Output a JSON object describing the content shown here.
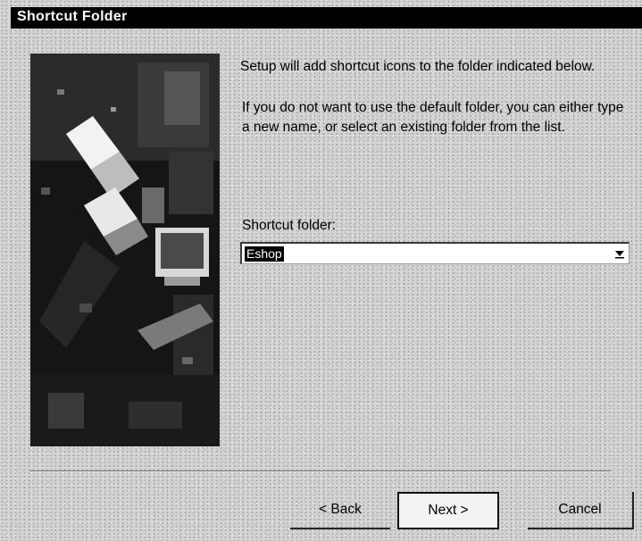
{
  "window": {
    "title": "Shortcut Folder"
  },
  "body": {
    "intro": "Setup will add shortcut icons to the folder indicated below.",
    "instructions": "If you do not want to use the default folder, you can either type a new name, or select an existing folder from the list."
  },
  "shortcut_folder": {
    "label": "Shortcut folder:",
    "value": "Eshop",
    "dropdown_icon": "chevron-down-icon"
  },
  "buttons": {
    "back": "< Back",
    "next": "Next >",
    "cancel": "Cancel"
  },
  "colors": {
    "title_bar": "#000000",
    "selection": "#000000"
  }
}
